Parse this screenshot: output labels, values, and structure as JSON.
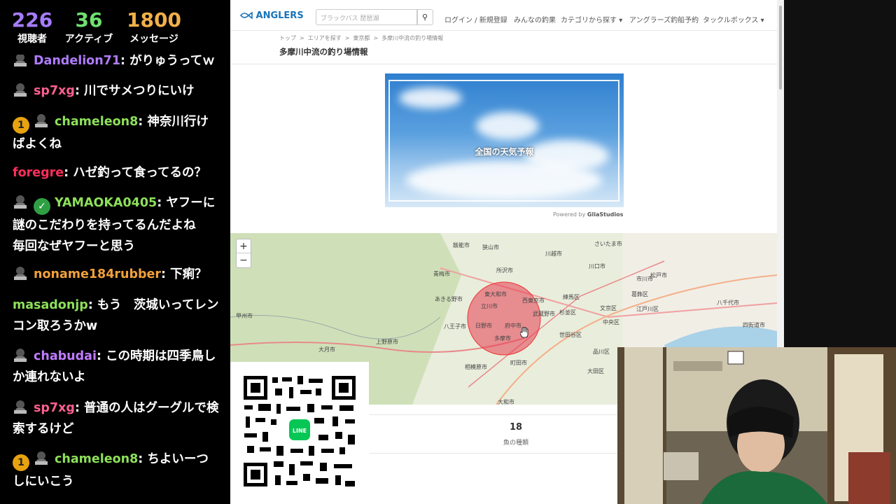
{
  "stream_stats": {
    "viewers": {
      "value": "226",
      "label": "視聴者",
      "color": "#a67cff"
    },
    "active": {
      "value": "36",
      "label": "アクティブ",
      "color": "#6fe06f"
    },
    "messages": {
      "value": "1800",
      "label": "メッセージ",
      "color": "#f2b04a"
    }
  },
  "chat": {
    "messages": [
      {
        "user": "Dandelion71",
        "color": "#b07cff",
        "text": "がりゅうってｗ",
        "badge": "",
        "verified": false
      },
      {
        "user": "sp7xg",
        "color": "#ff5f8f",
        "text": "川でサメつりにいけ",
        "badge": "",
        "verified": false
      },
      {
        "user": "chameleon8",
        "color": "#8de05a",
        "text": "神奈川行けばよくね",
        "badge": "1",
        "verified": false
      },
      {
        "user": "foregre",
        "color": "#ff2e5a",
        "text": "ハゼ釣って食ってるの？",
        "badge": "",
        "verified": false
      },
      {
        "user": "YAMAOKA0405",
        "color": "#8de05a",
        "text": "ヤフーに謎のこだわりを持ってるんだよね　毎回なぜヤフーと思う",
        "badge": "",
        "verified": true
      },
      {
        "user": "noname184rubber",
        "color": "#f2a03a",
        "text": "下痢？",
        "badge": "",
        "verified": false
      },
      {
        "user": "masadonjp",
        "color": "#8de05a",
        "text": "もう　茨城いってレンコン取ろうかw",
        "badge": "",
        "verified": false
      },
      {
        "user": "chabudai",
        "color": "#c07cff",
        "text": "この時期は四季鳥しか連れないよ",
        "badge": "",
        "verified": false
      },
      {
        "user": "sp7xg",
        "color": "#ff5f8f",
        "text": "普通の人はグーグルで検索するけど",
        "badge": "",
        "verified": false
      },
      {
        "user": "chameleon8",
        "color": "#8de05a",
        "text": "ちよいーつしにいこう",
        "badge": "1",
        "verified": false
      }
    ]
  },
  "site": {
    "logo": "ANGLERS",
    "search_placeholder": "ブラックバス 琵琶湖",
    "nav": {
      "login": "ログイン / 新規登録",
      "catches": "みんなの釣果",
      "category": "カテゴリから探す",
      "booking": "アングラーズ釣船予約",
      "tacklebox": "タックルボックス"
    },
    "breadcrumb": [
      "トップ",
      ">",
      "エリアを探す",
      ">",
      "東京都",
      ">",
      "多摩川中流の釣り場情報"
    ],
    "title": "多摩川中流の釣り場情報",
    "weather_label": "全国の天気予報",
    "powered_prefix": "Powered by",
    "powered_brand": "GliaStudios",
    "map": {
      "zoom_in": "+",
      "zoom_out": "−",
      "labels": [
        "飯能市",
        "狭山市",
        "川越市",
        "さいたま市",
        "川口市",
        "市川市",
        "青梅市",
        "所沢市",
        "東大和市",
        "西東京市",
        "練馬区",
        "葛飾区",
        "松戸市",
        "あきる野市",
        "立川市",
        "武蔵野市",
        "杉並区",
        "文京区",
        "江戸川区",
        "八千代市",
        "八王子市",
        "日野市",
        "府中市",
        "世田谷区",
        "中央区",
        "上野原市",
        "多摩市",
        "町田市",
        "相模原市",
        "大和市",
        "大月市",
        "大田区",
        "品川区",
        "甲州市",
        "四街道市"
      ]
    },
    "stat": {
      "value": "18",
      "label": "魚の種類"
    }
  },
  "qr": {
    "icon": "LINE"
  }
}
